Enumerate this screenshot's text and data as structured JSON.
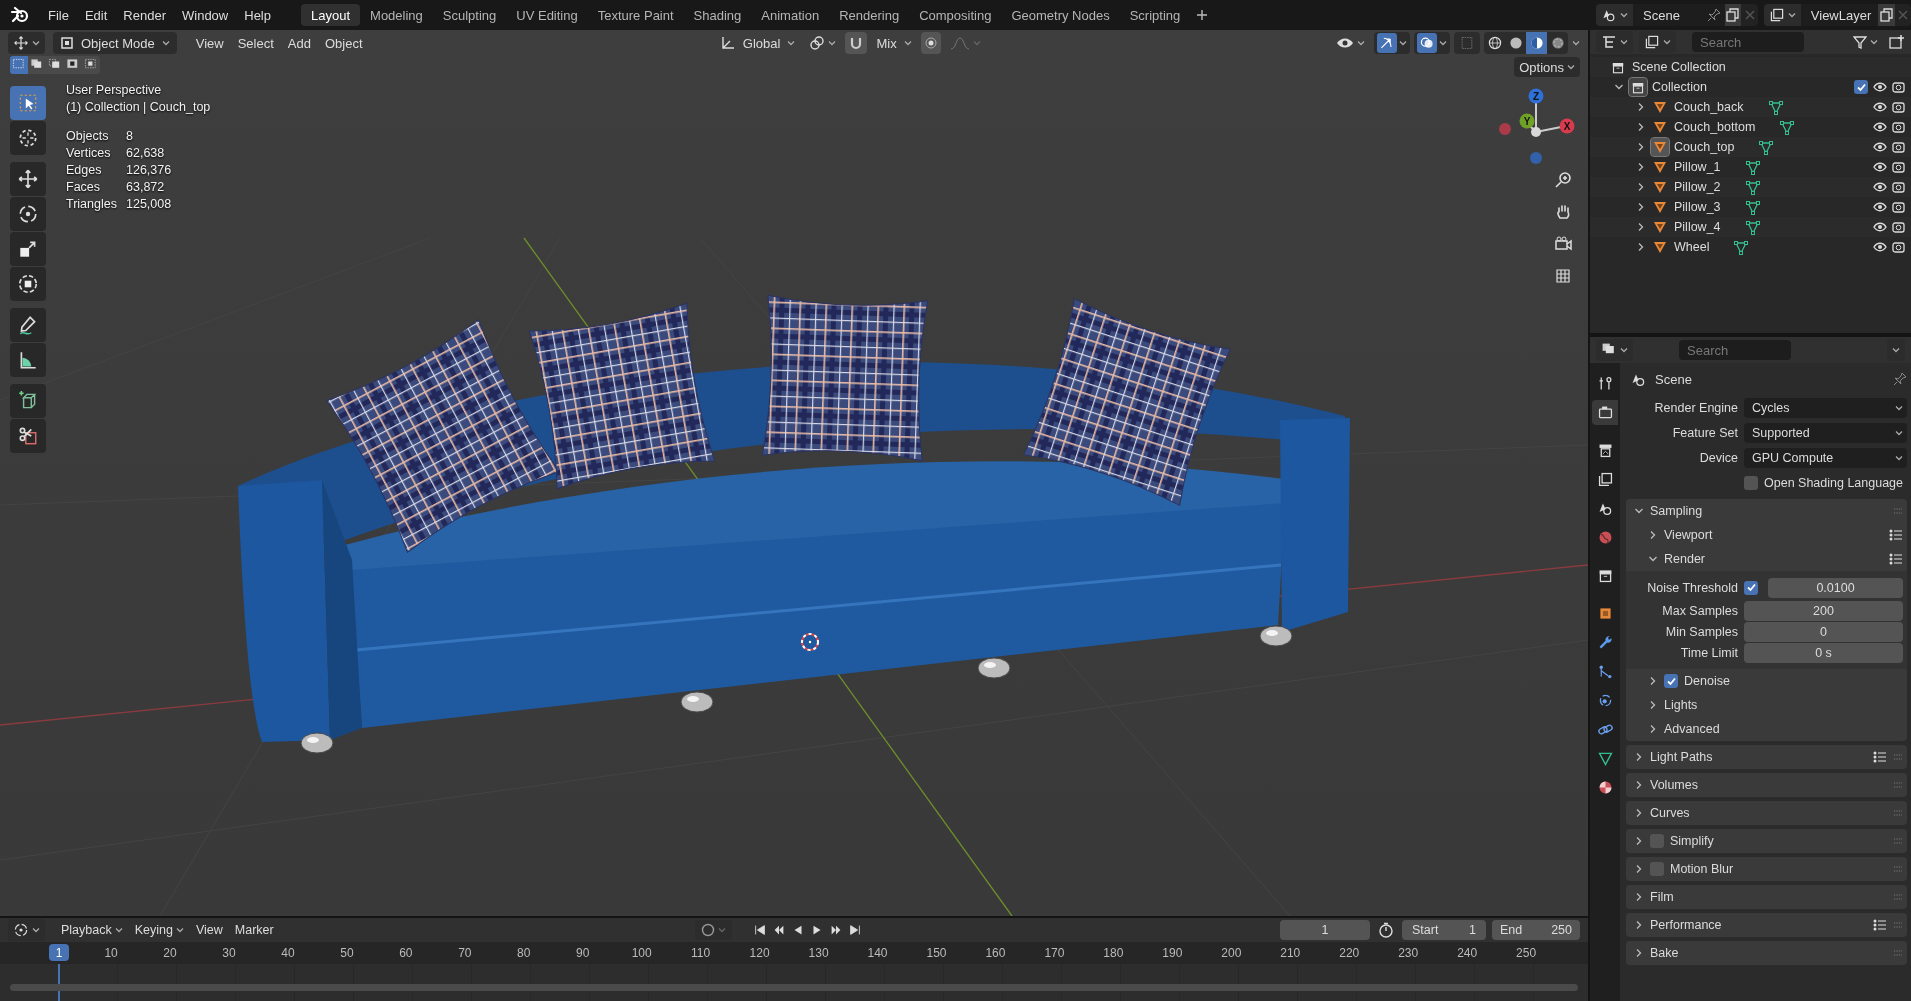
{
  "menu": [
    "File",
    "Edit",
    "Render",
    "Window",
    "Help"
  ],
  "workspaces": [
    {
      "label": "Layout",
      "selected": true
    },
    {
      "label": "Modeling",
      "selected": false
    },
    {
      "label": "Sculpting",
      "selected": false
    },
    {
      "label": "UV Editing",
      "selected": false
    },
    {
      "label": "Texture Paint",
      "selected": false
    },
    {
      "label": "Shading",
      "selected": false
    },
    {
      "label": "Animation",
      "selected": false
    },
    {
      "label": "Rendering",
      "selected": false
    },
    {
      "label": "Compositing",
      "selected": false
    },
    {
      "label": "Geometry Nodes",
      "selected": false
    },
    {
      "label": "Scripting",
      "selected": false
    }
  ],
  "scene": "Scene",
  "view_layer": "ViewLayer",
  "viewport": {
    "mode": "Object Mode",
    "menus": [
      "View",
      "Select",
      "Add",
      "Object"
    ],
    "orientation": "Global",
    "pivot": "Mix",
    "options": "Options",
    "select_modes": [
      {
        "kind": "set",
        "selected": true
      },
      {
        "kind": "extend",
        "selected": false
      },
      {
        "kind": "subtract",
        "selected": false
      },
      {
        "kind": "difference",
        "selected": false
      },
      {
        "kind": "intersect",
        "selected": false
      }
    ],
    "toggles": [
      {
        "kind": "gizmo",
        "on": true
      },
      {
        "kind": "overlay",
        "on": true
      },
      {
        "kind": "xray",
        "on": false
      }
    ],
    "shading": [
      {
        "kind": "wireframe",
        "selected": false
      },
      {
        "kind": "solid",
        "selected": false
      },
      {
        "kind": "material",
        "selected": true
      },
      {
        "kind": "rendered",
        "selected": false
      }
    ],
    "tools": [
      {
        "kind": "select",
        "selected": true
      },
      {
        "kind": "cursor",
        "selected": false
      },
      {
        "kind": "move",
        "selected": false
      },
      {
        "kind": "rotate",
        "selected": false
      },
      {
        "kind": "scale",
        "selected": false
      },
      {
        "kind": "transform",
        "selected": false
      },
      {
        "kind": "annotate",
        "selected": false
      },
      {
        "kind": "measure",
        "selected": false
      },
      {
        "kind": "add-cube",
        "selected": false
      },
      {
        "kind": "cut",
        "selected": false
      }
    ],
    "view_name": "User Perspective",
    "context": "(1) Collection | Couch_top",
    "stats": [
      {
        "label": "Objects",
        "value": "8"
      },
      {
        "label": "Vertices",
        "value": "62,638"
      },
      {
        "label": "Edges",
        "value": "126,376"
      },
      {
        "label": "Faces",
        "value": "63,872"
      },
      {
        "label": "Triangles",
        "value": "125,008"
      }
    ],
    "gizmo_axes": [
      {
        "label": "Z",
        "color": "#2e6fd8"
      },
      {
        "label": "Y",
        "color": "#6ea126"
      },
      {
        "label": "X",
        "color": "#d83a4e"
      }
    ]
  },
  "timeline": {
    "menus": [
      "Playback",
      "Keying",
      "View",
      "Marker"
    ],
    "current_frame": "1",
    "start_label": "Start",
    "start": "1",
    "end_label": "End",
    "end": "250",
    "playhead": "1",
    "ruler": [
      "10",
      "20",
      "30",
      "40",
      "50",
      "60",
      "70",
      "80",
      "90",
      "100",
      "110",
      "120",
      "130",
      "140",
      "150",
      "160",
      "170",
      "180",
      "190",
      "200",
      "210",
      "220",
      "230",
      "240",
      "250"
    ]
  },
  "outliner": {
    "search_placeholder": "Search",
    "root": "Scene Collection",
    "collections": [
      {
        "name": "Collection",
        "expanded": true,
        "checked": true,
        "children": [
          {
            "name": "Couch_back",
            "selected": false,
            "expanded": false
          },
          {
            "name": "Couch_bottom",
            "selected": false,
            "expanded": false
          },
          {
            "name": "Couch_top",
            "selected": true,
            "expanded": false
          },
          {
            "name": "Pillow_1",
            "selected": false,
            "expanded": false
          },
          {
            "name": "Pillow_2",
            "selected": false,
            "expanded": false
          },
          {
            "name": "Pillow_3",
            "selected": false,
            "expanded": false
          },
          {
            "name": "Pillow_4",
            "selected": false,
            "expanded": false
          },
          {
            "name": "Wheel",
            "selected": false,
            "expanded": false
          }
        ]
      }
    ]
  },
  "properties": {
    "search_placeholder": "Search",
    "context": "Scene",
    "tabs": [
      {
        "kind": "tool",
        "selected": false
      },
      {
        "kind": "render",
        "selected": true
      },
      {
        "kind": "output",
        "selected": false
      },
      {
        "kind": "view-layer",
        "selected": false
      },
      {
        "kind": "scene",
        "selected": false
      },
      {
        "kind": "world",
        "selected": false
      },
      {
        "kind": "collection",
        "selected": false
      },
      {
        "kind": "object",
        "selected": false
      },
      {
        "kind": "modifiers",
        "selected": false
      },
      {
        "kind": "particles",
        "selected": false
      },
      {
        "kind": "physics",
        "selected": false
      },
      {
        "kind": "constraints",
        "selected": false
      },
      {
        "kind": "data",
        "selected": false
      },
      {
        "kind": "material",
        "selected": false
      }
    ],
    "fields": [
      {
        "label": "Render Engine",
        "value": "Cycles"
      },
      {
        "label": "Feature Set",
        "value": "Supported"
      },
      {
        "label": "Device",
        "value": "GPU Compute"
      }
    ],
    "osl": {
      "label": "Open Shading Language",
      "checked": false
    },
    "panels": [
      {
        "title": "Sampling",
        "expanded": true,
        "subpanels": [
          {
            "title": "Viewport",
            "expanded": false,
            "presets": true
          },
          {
            "title": "Render",
            "expanded": true,
            "presets": true,
            "rows": [
              {
                "kind": "check-number",
                "label": "Noise Threshold",
                "checked": true,
                "value": "0.0100"
              },
              {
                "kind": "number",
                "label": "Max Samples",
                "value": "200"
              },
              {
                "kind": "number",
                "label": "Min Samples",
                "value": "0"
              },
              {
                "kind": "number",
                "label": "Time Limit",
                "value": "0 s"
              }
            ]
          },
          {
            "title": "Denoise",
            "expanded": false,
            "checked": true
          },
          {
            "title": "Lights",
            "expanded": false
          },
          {
            "title": "Advanced",
            "expanded": false
          }
        ]
      },
      {
        "title": "Light Paths",
        "expanded": false,
        "presets": true
      },
      {
        "title": "Volumes",
        "expanded": false
      },
      {
        "title": "Curves",
        "expanded": false
      },
      {
        "title": "Simplify",
        "expanded": false,
        "checked": false
      },
      {
        "title": "Motion Blur",
        "expanded": false,
        "checked": false
      },
      {
        "title": "Film",
        "expanded": false
      },
      {
        "title": "Performance",
        "expanded": false,
        "presets": true
      },
      {
        "title": "Bake",
        "expanded": false
      }
    ]
  }
}
